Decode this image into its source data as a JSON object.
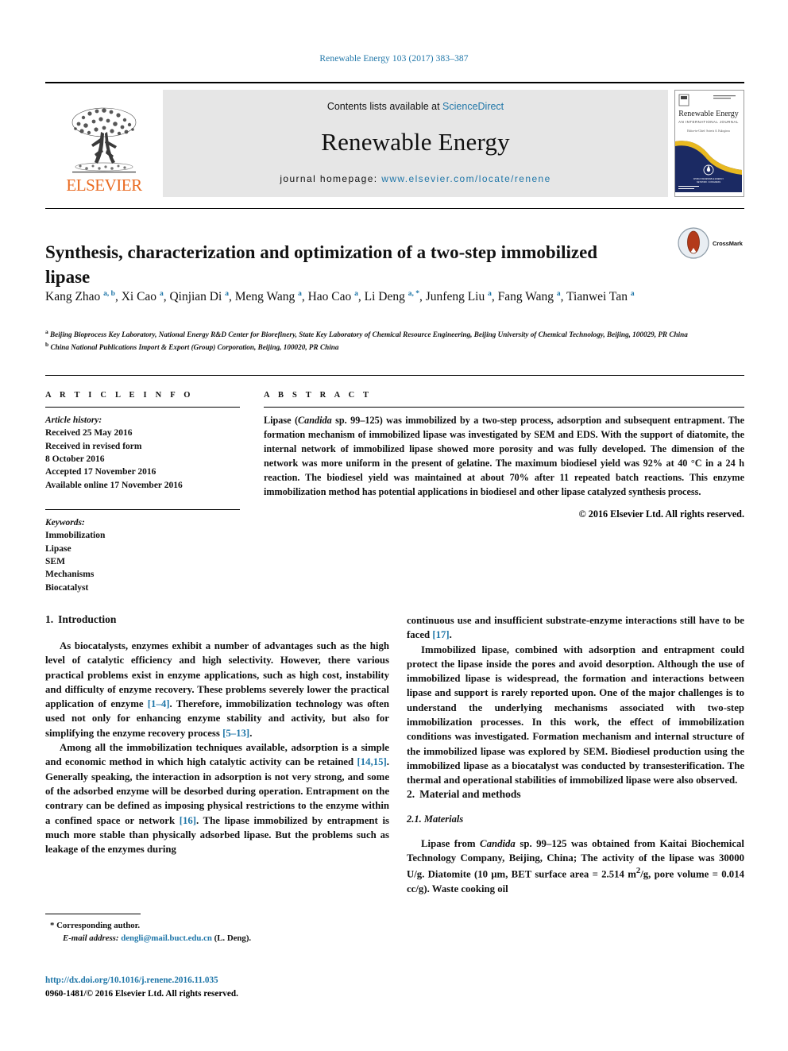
{
  "running_head": "Renewable Energy 103 (2017) 383–387",
  "banner": {
    "publisher": "ELSEVIER",
    "contents_prefix": "Contents lists available at ",
    "contents_link": "ScienceDirect",
    "journal_name": "Renewable Energy",
    "homepage_prefix": "journal homepage: ",
    "homepage_url": "www.elsevier.com/locate/renene",
    "cover": {
      "title": "Renewable Energy",
      "subtitle": "AN INTERNATIONAL JOURNAL",
      "tagline": "Editor-in-Chief: Soteris A. Kalogirou"
    }
  },
  "article": {
    "title": "Synthesis, characterization and optimization of a two-step immobilized lipase",
    "crossmark_label": "CrossMark",
    "authors": [
      {
        "name": "Kang Zhao",
        "marks": "a, b"
      },
      {
        "name": "Xi Cao",
        "marks": "a"
      },
      {
        "name": "Qinjian Di",
        "marks": "a"
      },
      {
        "name": "Meng Wang",
        "marks": "a"
      },
      {
        "name": "Hao Cao",
        "marks": "a"
      },
      {
        "name": "Li Deng",
        "marks": "a, *"
      },
      {
        "name": "Junfeng Liu",
        "marks": "a"
      },
      {
        "name": "Fang Wang",
        "marks": "a"
      },
      {
        "name": "Tianwei Tan",
        "marks": "a"
      }
    ],
    "affiliations": [
      {
        "mark": "a",
        "text": "Beijing Bioprocess Key Laboratory, National Energy R&D Center for Biorefinery, State Key Laboratory of Chemical Resource Engineering, Beijing University of Chemical Technology, Beijing, 100029, PR China"
      },
      {
        "mark": "b",
        "text": "China National Publications Import & Export (Group) Corporation, Beijing, 100020, PR China"
      }
    ]
  },
  "article_info": {
    "heading": "A R T I C L E   I N F O",
    "history_heading": "Article history:",
    "history": [
      "Received 25 May 2016",
      "Received in revised form",
      "8 October 2016",
      "Accepted 17 November 2016",
      "Available online 17 November 2016"
    ],
    "keywords_heading": "Keywords:",
    "keywords": [
      "Immobilization",
      "Lipase",
      "SEM",
      "Mechanisms",
      "Biocatalyst"
    ]
  },
  "abstract": {
    "heading": "A B S T R A C T",
    "text_part1": "Lipase (",
    "organism": "Candida",
    "text_part2": " sp. 99–125) was immobilized by a two-step process, adsorption and subsequent entrapment. The formation mechanism of immobilized lipase was investigated by SEM and EDS. With the support of diatomite, the internal network of immobilized lipase showed more porosity and was fully developed. The dimension of the network was more uniform in the present of gelatine. The maximum biodiesel yield was 92% at 40 °C in a 24 h reaction. The biodiesel yield was maintained at about 70% after 11 repeated batch reactions. This enzyme immobilization method has potential applications in biodiesel and other lipase catalyzed synthesis process.",
    "copyright": "© 2016 Elsevier Ltd. All rights reserved."
  },
  "body": {
    "intro_number": "1.",
    "intro_heading": "Introduction",
    "para1_a": "As biocatalysts, enzymes exhibit a number of advantages such as the high level of catalytic efficiency and high selectivity. However, there various practical problems exist in enzyme applications, such as high cost, instability and difficulty of enzyme recovery. These problems severely lower the practical application of enzyme ",
    "para1_ref1": "[1–4]",
    "para1_b": ". Therefore, immobilization technology was often used not only for enhancing enzyme stability and activity, but also for simplifying the enzyme recovery process ",
    "para1_ref2": "[5–13]",
    "para1_c": ".",
    "para2_a": "Among all the immobilization techniques available, adsorption is a simple and economic method in which high catalytic activity can be retained ",
    "para2_ref1": "[14,15]",
    "para2_b": ". Generally speaking, the interaction in adsorption is not very strong, and some of the adsorbed enzyme will be desorbed during operation. Entrapment on the contrary can be defined as imposing physical restrictions to the enzyme within a confined space or network ",
    "para2_ref2": "[16]",
    "para2_c": ". The lipase immobilized by entrapment is much more stable than physically adsorbed lipase. But the problems such as leakage of the enzymes during",
    "para3_a": "continuous use and insufficient substrate-enzyme interactions still have to be faced ",
    "para3_ref1": "[17]",
    "para3_b": ".",
    "para4": "Immobilized lipase, combined with adsorption and entrapment could protect the lipase inside the pores and avoid desorption. Although the use of immobilized lipase is widespread, the formation and interactions between lipase and support is rarely reported upon. One of the major challenges is to understand the underlying mechanisms associated with two-step immobilization processes. In this work, the effect of immobilization conditions was investigated. Formation mechanism and internal structure of the immobilized lipase was explored by SEM. Biodiesel production using the immobilized lipase as a biocatalyst was conducted by transesterification. The thermal and operational stabilities of immobilized lipase were also observed.",
    "methods_number": "2.",
    "methods_heading": "Material and methods",
    "materials_number": "2.1.",
    "materials_heading": "Materials",
    "materials_a": "Lipase from ",
    "materials_organism": "Candida",
    "materials_b": " sp. 99–125 was obtained from Kaitai Biochemical Technology Company, Beijing, China; The activity of the lipase was 30000 U/g. Diatomite (10 μm, BET surface area = 2.514 m",
    "materials_sup": "2",
    "materials_c": "/g, pore volume = 0.014 cc/g). Waste cooking oil"
  },
  "footer": {
    "corresponding_marker": "*",
    "corresponding_label": "Corresponding author.",
    "email_label": "E-mail address:",
    "email": "dengli@mail.buct.edu.cn",
    "email_owner": "(L. Deng).",
    "doi": "http://dx.doi.org/10.1016/j.renene.2016.11.035",
    "issn_line": "0960-1481/© 2016 Elsevier Ltd. All rights reserved."
  },
  "colors": {
    "link": "#1f76a8",
    "elsevier_orange": "#ea6a20",
    "banner_bg": "#e6e6e6"
  }
}
